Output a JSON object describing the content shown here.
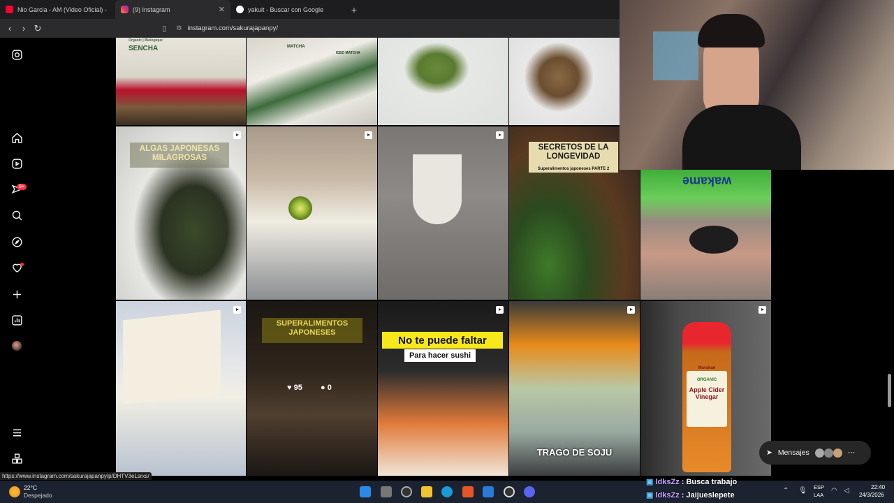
{
  "browser": {
    "tabs": [
      {
        "label": "Nio Garcia - AM (Video Oficial) -",
        "color": "#ff0033"
      },
      {
        "label": "(9) Instagram",
        "color": "#e1306c"
      },
      {
        "label": "yakuit - Buscar con Google",
        "color": "#4285f4"
      }
    ],
    "url": "instagram.com/sakurajapanpy/",
    "status_url": "https://www.instagram.com/sakurajapanpy/p/DHTV3eLsrxs/"
  },
  "sidebar": {
    "notification_count": "9+",
    "items": [
      "instagram-logo",
      "home",
      "reels",
      "messages",
      "search",
      "explore",
      "notifications",
      "create",
      "dashboard",
      "profile",
      "more",
      "meta"
    ]
  },
  "posts": [
    {
      "row": 0,
      "col": 0,
      "caption": "SENCHA",
      "subcaption": "Organic | Biologique"
    },
    {
      "row": 0,
      "col": 1,
      "caption": "MATCHA",
      "subcaption": "ICED MATCHA"
    },
    {
      "row": 0,
      "col": 2,
      "caption": ""
    },
    {
      "row": 0,
      "col": 3,
      "caption": ""
    },
    {
      "row": 1,
      "col": 0,
      "caption": "ALGAS JAPONESAS MILAGROSAS"
    },
    {
      "row": 1,
      "col": 1,
      "caption": ""
    },
    {
      "row": 1,
      "col": 2,
      "caption": ""
    },
    {
      "row": 1,
      "col": 3,
      "caption": "SECRETOS DE LA LONGEVIDAD",
      "subcaption": "Superalimentos japoneses PARTE 2"
    },
    {
      "row": 1,
      "col": 4,
      "caption": "wakame"
    },
    {
      "row": 2,
      "col": 0,
      "caption": ""
    },
    {
      "row": 2,
      "col": 1,
      "caption": "SUPERALIMENTOS JAPONESES",
      "likes": "95",
      "comments": "0"
    },
    {
      "row": 2,
      "col": 2,
      "caption": "No te puede faltar",
      "subcaption": "Para hacer sushi"
    },
    {
      "row": 2,
      "col": 3,
      "caption": "TRAGO DE SOJU"
    },
    {
      "row": 2,
      "col": 4,
      "caption": "Apple Cider Vinegar",
      "subcaption": "ORGANIC",
      "brand": "Marukan"
    }
  ],
  "messages_button": {
    "label": "Mensajes",
    "badge": "9+"
  },
  "chat": [
    {
      "user": "ldksZz",
      "message": "Busca trabajo"
    },
    {
      "user": "ldksZz",
      "message": "Jaijueslepete"
    }
  ],
  "taskbar": {
    "weather_temp": "22°C",
    "weather_desc": "Despejado",
    "lang": "ESP",
    "lang2": "LAA",
    "time": "22:40",
    "date": "24/3/2026"
  }
}
